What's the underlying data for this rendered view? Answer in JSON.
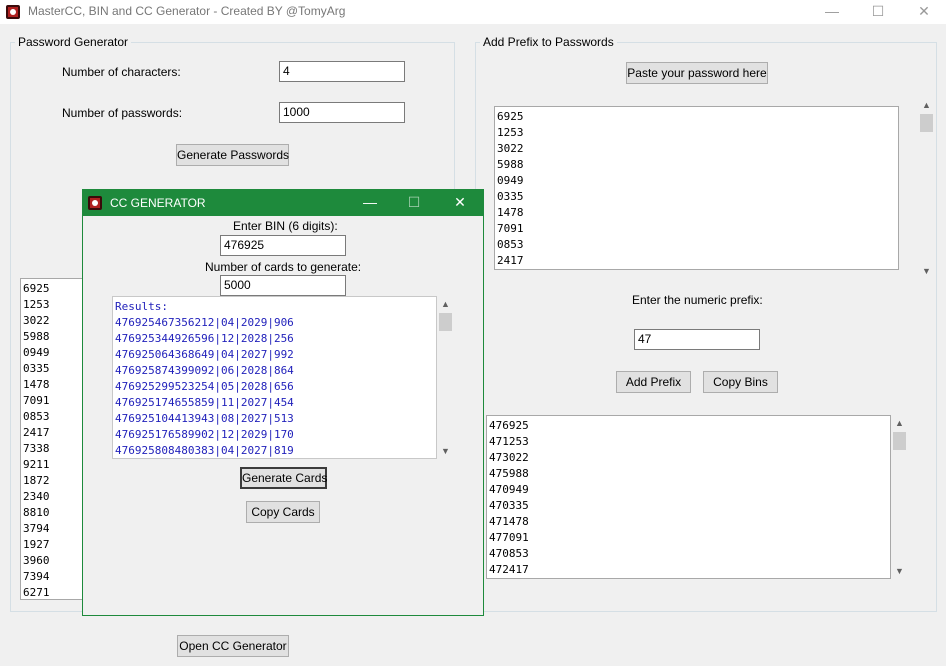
{
  "window": {
    "title": "MasterCC, BIN and CC Generator - Created BY @TomyArg",
    "minimize": "—",
    "maximize": "☐",
    "close": "✕"
  },
  "password_generator": {
    "group_label": "Password Generator",
    "num_chars_label": "Number of characters:",
    "num_chars_value": "4",
    "num_passwords_label": "Number of passwords:",
    "num_passwords_value": "1000",
    "generate_button": "Generate Passwords",
    "output_text": "6925\n1253\n3022\n5988\n0949\n0335\n1478\n7091\n0853\n2417\n7338\n9211\n1872\n2340\n8810\n3794\n1927\n3960\n7394\n6271"
  },
  "add_prefix": {
    "group_label": "Add Prefix to Passwords",
    "paste_button": "Paste your password here",
    "input_text": "6925\n1253\n3022\n5988\n0949\n0335\n1478\n7091\n0853\n2417",
    "prefix_label": "Enter the numeric prefix:",
    "prefix_value": "47",
    "add_prefix_button": "Add Prefix",
    "copy_bins_button": "Copy Bins",
    "output_text": "476925\n471253\n473022\n475988\n470949\n470335\n471478\n477091\n470853\n472417"
  },
  "open_cc_button": "Open CC Generator",
  "cc_dialog": {
    "title": "CC GENERATOR",
    "minimize": "—",
    "maximize": "☐",
    "close": "✕",
    "bin_label": "Enter BIN (6 digits):",
    "bin_value": "476925",
    "count_label": "Number of cards to generate:",
    "count_value": "5000",
    "results_text": "Results:\n476925467356212|04|2029|906\n476925344926596|12|2028|256\n476925064368649|04|2027|992\n476925874399092|06|2028|864\n476925299523254|05|2028|656\n476925174655859|11|2027|454\n476925104413943|08|2027|513\n476925176589902|12|2029|170\n476925808480383|04|2027|819",
    "generate_button": "Generate Cards",
    "copy_button": "Copy Cards"
  },
  "colors": {
    "dialog_titlebar": "#1e8a3c",
    "results_text": "#2222bb"
  },
  "icons": {
    "app": "app-skull-icon",
    "scroll_up": "scroll-up-arrow-icon",
    "scroll_down": "scroll-down-arrow-icon"
  }
}
